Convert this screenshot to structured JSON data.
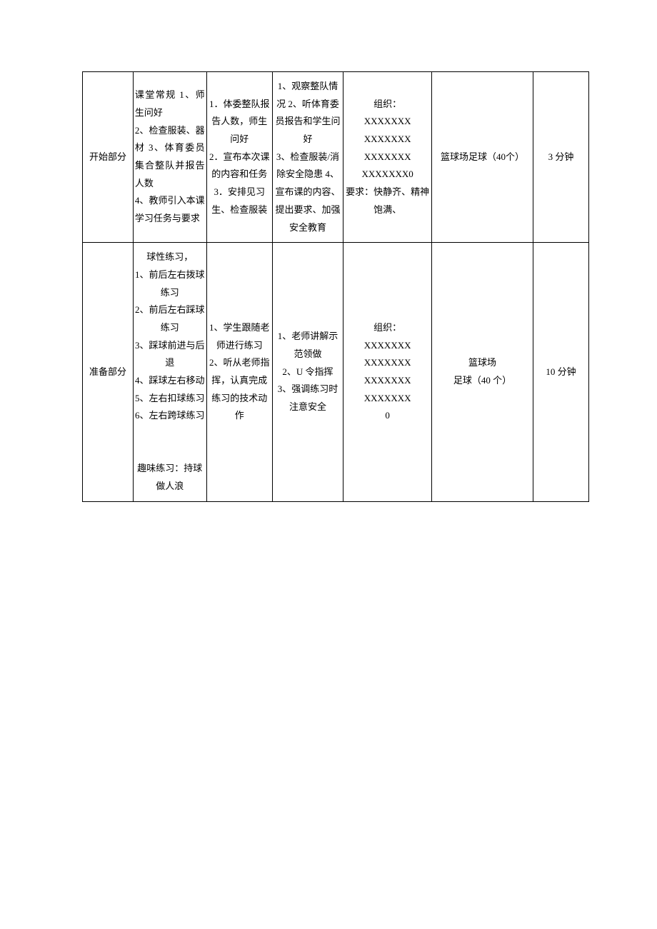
{
  "rows": [
    {
      "section": "开始部分",
      "content": "课堂常规 1、师生问好\n2、检查服装、器材 3、体育委员集合整队并报告人数\n4、教师引入本课学习任务与要求",
      "student": "1．体委整队报告人数，师生问好\n2．宣布本次课的内容和任务\n3．安排见习生、检查服装",
      "teacher": "1、观察整队情况 2、听体育委员报告和学生问好\n3、检查服装/消除安全隐患 4、宣布课的内容、提出要求、加强安全教育",
      "org": "组织：\nXXXXXXX\nXXXXXXX\nXXXXXXX\nXXXXXXX0\n要求：快静齐、精神饱满、",
      "equipment": "篮球场足球（40个）",
      "time": "3 分钟"
    },
    {
      "section": "准备部分",
      "content": "球性练习，\n1、前后左右拨球练习\n2、前后左右踩球练习\n3、踩球前进与后退\n4、踩球左右移动\n5、左右扣球练习 6、左右跨球练习\n\n\n趣味练习：持球做人浪",
      "student": "1、学生跟随老师进行练习 2、听从老师指挥，认真完成练习的技术动\n作",
      "teacher": "1、老师讲解示范领做\n2、U 令指挥\n3、强调练习时注意安全",
      "org": "组织：\nXXXXXXX\nXXXXXXX\nXXXXXXX\nXXXXXXX\n0",
      "equipment": "篮球场\n足球（40 个）",
      "time": "10 分钟"
    }
  ]
}
